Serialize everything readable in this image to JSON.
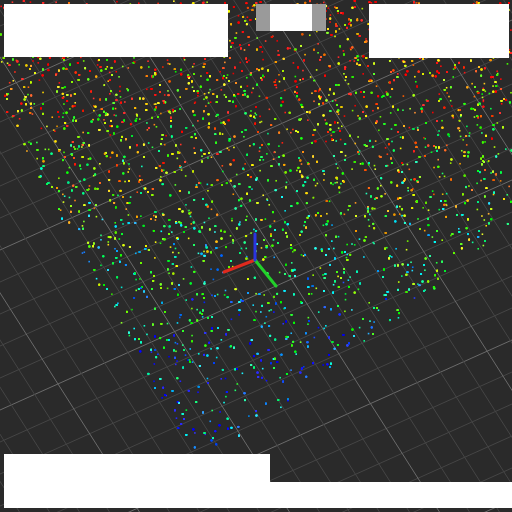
{
  "axes": [
    {
      "color": "#e02a1e"
    },
    {
      "color": "#22d02a"
    },
    {
      "color": "#2a35e0"
    }
  ]
}
